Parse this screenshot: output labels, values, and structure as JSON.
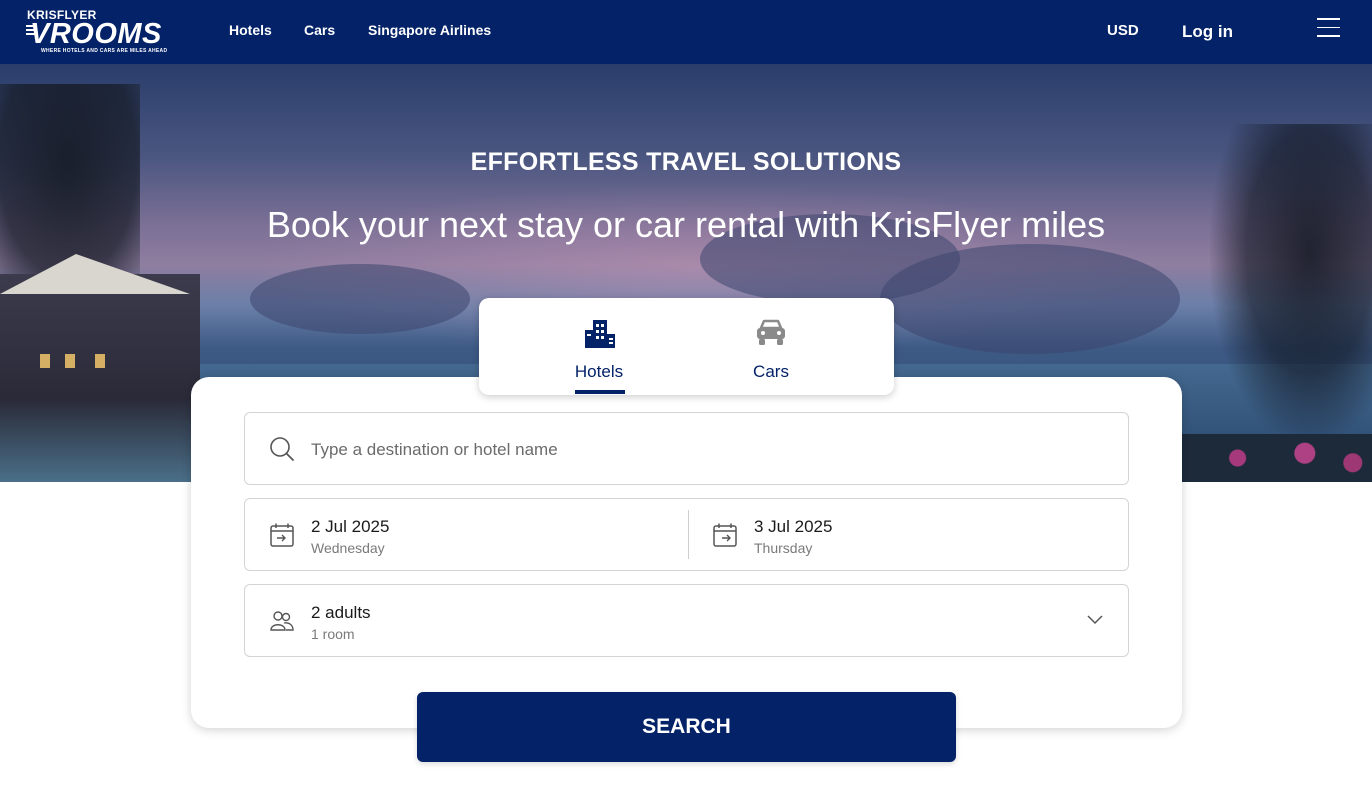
{
  "brand": {
    "top_text": "KRISFLYER",
    "name": "VROOMS",
    "tagline": "WHERE HOTELS AND CARS ARE MILES AHEAD"
  },
  "nav": {
    "links": [
      "Hotels",
      "Cars",
      "Singapore Airlines"
    ],
    "currency": "USD",
    "login": "Log in"
  },
  "hero": {
    "kicker": "EFFORTLESS TRAVEL SOLUTIONS",
    "headline": "Book your next stay or car rental with KrisFlyer miles"
  },
  "tabs": [
    {
      "label": "Hotels",
      "icon": "hotel-building-icon",
      "active": true
    },
    {
      "label": "Cars",
      "icon": "car-icon",
      "active": false
    }
  ],
  "search": {
    "placeholder": "Type a destination or hotel name"
  },
  "dates": {
    "checkin": {
      "date": "2 Jul 2025",
      "day": "Wednesday"
    },
    "checkout": {
      "date": "3 Jul 2025",
      "day": "Thursday"
    }
  },
  "guests": {
    "main": "2 adults",
    "sub": "1 room"
  },
  "search_button": "SEARCH",
  "colors": {
    "brand_navy": "#032268",
    "border": "#d4d4d4",
    "muted_text": "#7a7a7a"
  }
}
